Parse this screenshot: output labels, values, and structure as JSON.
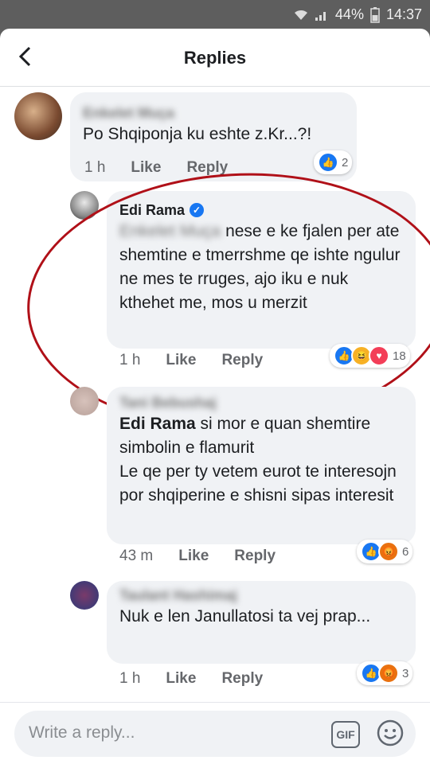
{
  "status": {
    "signal": "44%",
    "time": "14:37"
  },
  "header": {
    "title": "Replies"
  },
  "comments": [
    {
      "author": "Enkelet Muça",
      "text": "Po Shqiponja ku eshte z.Kr...?!",
      "time": "1 h",
      "like": "Like",
      "reply": "Reply",
      "reactions": "2"
    },
    {
      "author": "Edi Rama",
      "mention": "Enkelet Muça",
      "text": "nese e ke fjalen per ate shemtine e tmerrshme qe ishte ngulur ne mes te rruges, ajo iku e nuk kthehet me, mos u merzit",
      "time": "1 h",
      "like": "Like",
      "reply": "Reply",
      "reactions": "18"
    },
    {
      "author": "Tani Bebushaj",
      "mention": "Edi Rama",
      "text": "si mor e quan shemtire simbolin e flamurit",
      "text2": "Le qe per ty vetem eurot te interesojn por shqiperine e shisni sipas interesit",
      "time": "43 m",
      "like": "Like",
      "reply": "Reply",
      "reactions": "6"
    },
    {
      "author": "Taulant Hashimaj",
      "text": "Nuk e len Janullatosi ta vej prap...",
      "time": "1 h",
      "like": "Like",
      "reply": "Reply",
      "reactions": "3"
    }
  ],
  "composer": {
    "placeholder": "Write a reply...",
    "gif": "GIF"
  },
  "colors": {
    "like": "#1877f2",
    "highlight": "#b01018",
    "bubble": "#f0f2f5"
  }
}
